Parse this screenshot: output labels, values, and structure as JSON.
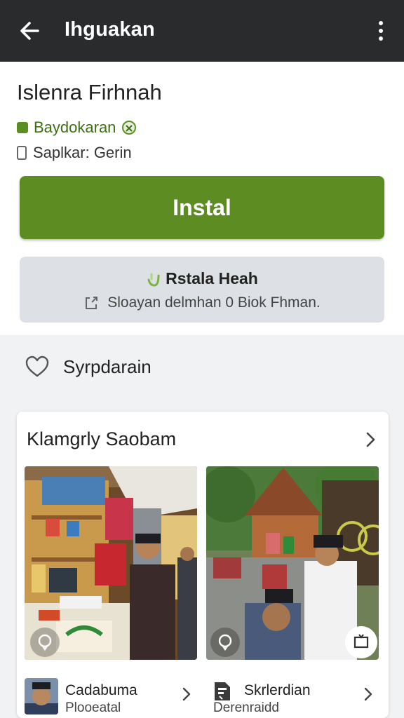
{
  "appbar": {
    "title": "Ihguakan",
    "back_icon": "arrow-left-icon",
    "menu_icon": "more-vert-icon"
  },
  "app": {
    "name": "Islenra Firhnah",
    "developer": "Baydokaran",
    "size_text": "Saplkar: Gerin"
  },
  "install_button": {
    "label": "Instal",
    "color": "#5c8c22"
  },
  "info_box": {
    "title": "Rstala Heah",
    "subtitle": "Sloayan delmhan 0 Biok Fhman."
  },
  "wishlist": {
    "label": "Syrpdarain",
    "icon": "heart-outline-icon"
  },
  "gallery": {
    "title": "Klamgrly Saobam",
    "items": [
      {
        "title": "Cadabuma",
        "subtitle": "Plooeatal",
        "icon": "avatar"
      },
      {
        "title": "Skrlerdian",
        "subtitle": "Derenraidd",
        "icon": "document-icon"
      }
    ]
  },
  "colors": {
    "appbar": "#2a2b2d",
    "accent_green": "#5c8c22",
    "info_bg": "#dde1e5"
  }
}
